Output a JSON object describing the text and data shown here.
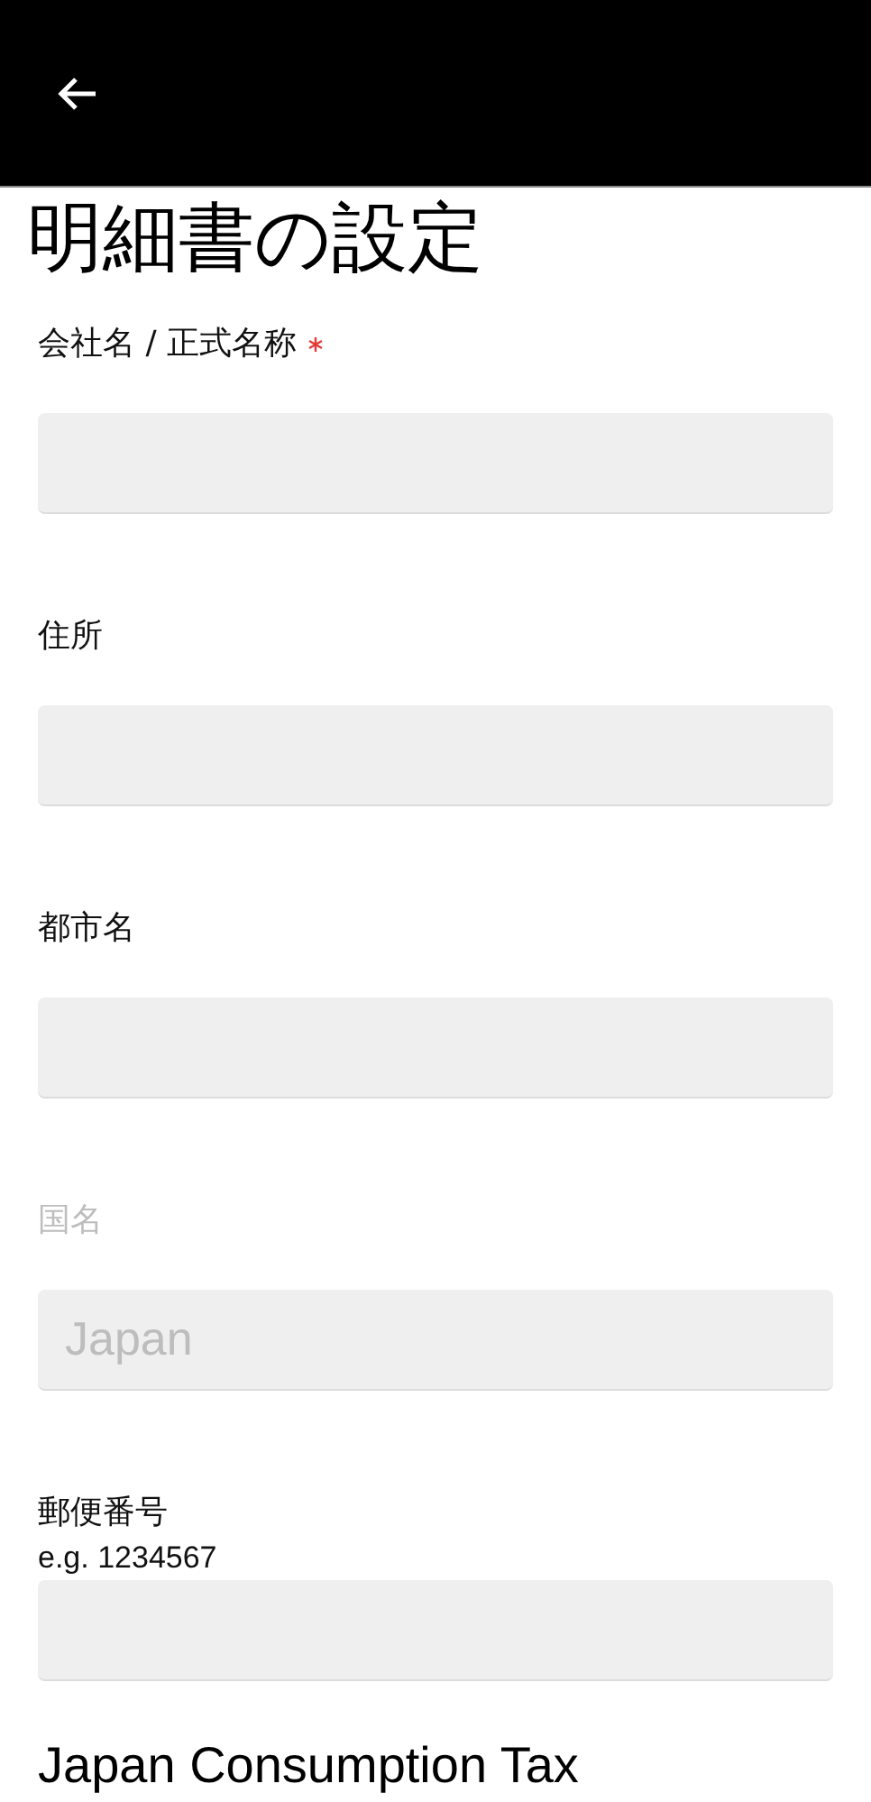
{
  "title": "明細書の設定",
  "fields": [
    {
      "label": "会社名 / 正式名称",
      "required": true,
      "disabled": false
    },
    {
      "label": "住所",
      "required": false,
      "disabled": false
    },
    {
      "label": "都市名",
      "required": false,
      "disabled": false
    },
    {
      "label": "国名",
      "required": false,
      "disabled": true,
      "value": "Japan"
    },
    {
      "label": "郵便番号",
      "required": false,
      "disabled": false,
      "hint": "e.g. 1234567"
    }
  ],
  "section_heading": "Japan Consumption Tax"
}
